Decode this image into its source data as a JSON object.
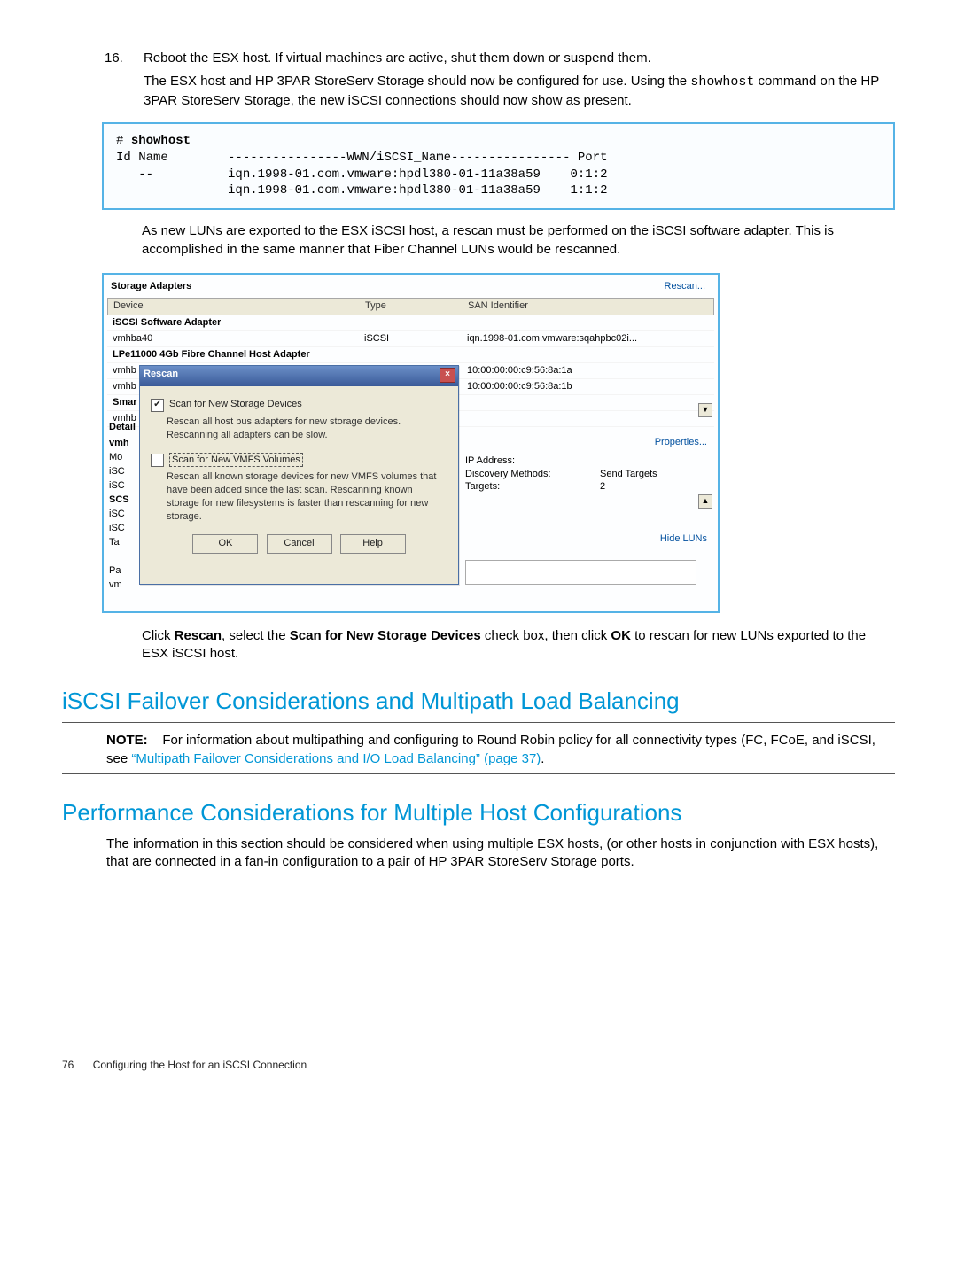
{
  "step": {
    "number": "16.",
    "line1": "Reboot the ESX host. If virtual machines are active, shut them down or suspend them.",
    "line2a": "The ESX host and HP 3PAR StoreServ Storage should now be configured for use. Using the ",
    "line2_cmd": "showhost",
    "line2b": " command on the HP 3PAR StoreServ Storage, the new iSCSI connections should now show as present."
  },
  "cli": {
    "prompt": "# ",
    "cmd": "showhost",
    "body": "Id Name        ----------------WWN/iSCSI_Name---------------- Port\n   --          iqn.1998-01.com.vmware:hpdl380-01-11a38a59    0:1:2\n               iqn.1998-01.com.vmware:hpdl380-01-11a38a59    1:1:2"
  },
  "para_rescan": "As new LUNs are exported to the ESX iSCSI host, a rescan must be performed on the iSCSI software adapter. This is accomplished in the same manner that Fiber Channel LUNs would be rescanned.",
  "ui": {
    "title": "Storage Adapters",
    "rescan_link": "Rescan...",
    "cols": {
      "device": "Device",
      "type": "Type",
      "san": "SAN Identifier"
    },
    "grp1": "iSCSI Software Adapter",
    "row1": {
      "d": "vmhba40",
      "t": "iSCSI",
      "s": "iqn.1998-01.com.vmware:sqahpbc02i..."
    },
    "grp2": "LPe11000 4Gb Fibre Channel Host Adapter",
    "row2": {
      "d": "vmhb",
      "s": "10:00:00:00:c9:56:8a:1a"
    },
    "row3": {
      "d": "vmhb",
      "s": "10:00:00:00:c9:56:8a:1b"
    },
    "row4": {
      "d": "Smar"
    },
    "row5": {
      "d": "vmhb"
    },
    "details_label": "Detail",
    "left": [
      "vmh",
      "Mo",
      "iSC",
      "iSC",
      "SCS",
      "iSC",
      "iSC",
      "Ta",
      "",
      "Pa",
      "vm"
    ],
    "dlg": {
      "title": "Rescan",
      "opt1": "Scan for New Storage Devices",
      "opt1_desc": "Rescan all host bus adapters for new storage devices. Rescanning all adapters can be slow.",
      "opt2": "Scan for New VMFS Volumes",
      "opt2_desc": "Rescan all known storage devices for new VMFS volumes that have been added since the last scan. Rescanning known storage for new filesystems is faster than rescanning for new storage.",
      "ok": "OK",
      "cancel": "Cancel",
      "help": "Help"
    },
    "right": {
      "props": "Properties...",
      "ip": "IP Address:",
      "disc": "Discovery Methods:",
      "disc_v": "Send Targets",
      "tgt": "Targets:",
      "tgt_v": "2",
      "hide": "Hide LUNs"
    }
  },
  "after": {
    "a": "Click ",
    "b": "Rescan",
    "c": ", select the ",
    "d": "Scan for New Storage Devices",
    "e": " check box, then click ",
    "f": "OK",
    "g": " to rescan for new LUNs exported to the ESX iSCSI host."
  },
  "h2a": "iSCSI Failover Considerations and Multipath Load Balancing",
  "note": {
    "lbl": "NOTE:",
    "txt": "For information about multipathing and configuring to Round Robin policy for all connectivity types (FC, FCoE, and iSCSI, see ",
    "link": "“Multipath Failover Considerations and I/O Load Balancing” (page 37)",
    "end": "."
  },
  "h2b": "Performance Considerations for Multiple Host Configurations",
  "perf": "The information in this section should be considered when using multiple ESX hosts, (or other hosts in conjunction with ESX hosts), that are connected in a fan-in configuration to a pair of HP 3PAR StoreServ Storage ports.",
  "footer": {
    "page": "76",
    "chapter": "Configuring the Host for an iSCSI Connection"
  }
}
